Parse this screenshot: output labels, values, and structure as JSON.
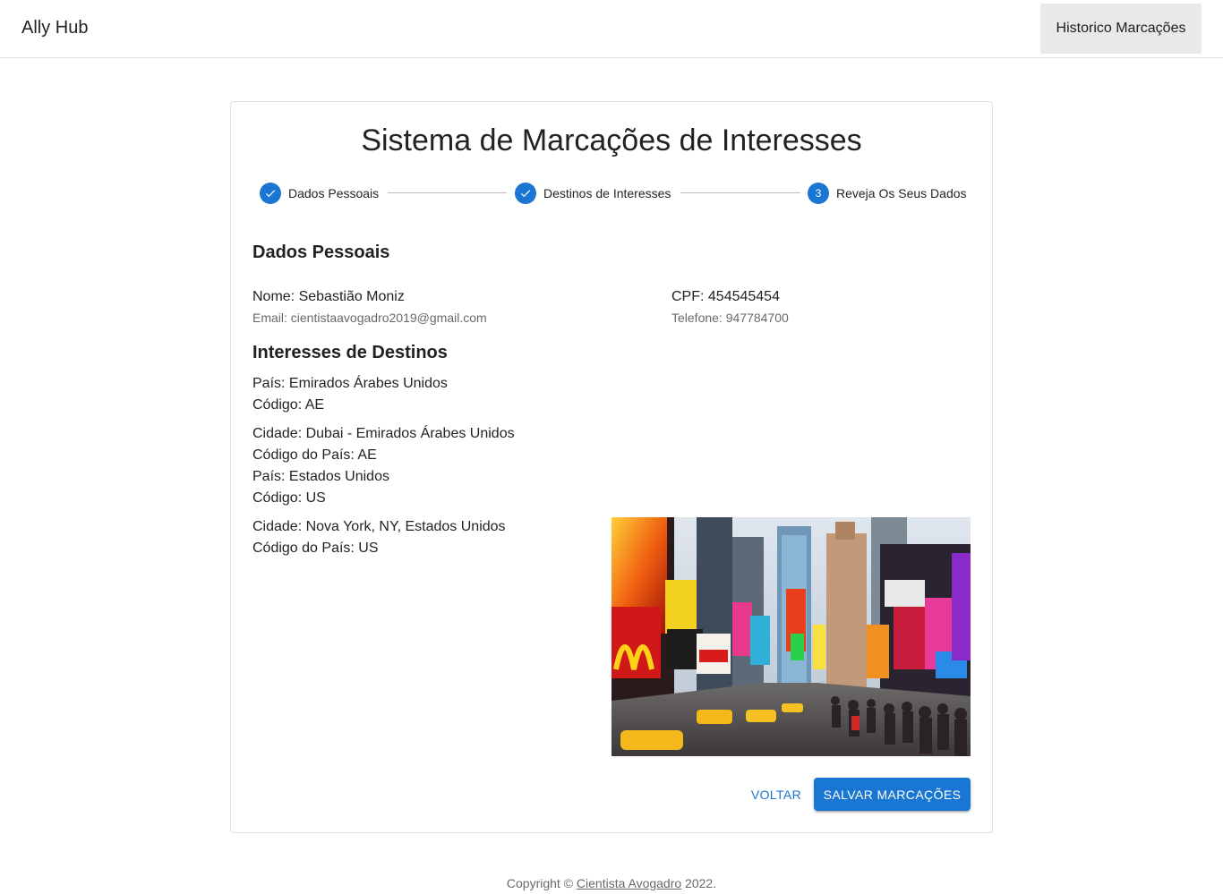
{
  "appbar": {
    "brand": "Ally Hub",
    "nav_button": "Historico Marcações"
  },
  "card": {
    "title": "Sistema de Marcações de Interesses",
    "steps": [
      {
        "label": "Dados Pessoais",
        "status": "completed",
        "icon": "check-icon"
      },
      {
        "label": "Destinos de Interesses",
        "status": "completed",
        "icon": "check-icon"
      },
      {
        "label": "Reveja Os Seus Dados",
        "status": "active",
        "number": "3"
      }
    ],
    "personal": {
      "heading": "Dados Pessoais",
      "name": "Nome: Sebastião Moniz",
      "email": "Email: cientistaavogadro2019@gmail.com",
      "cpf": "CPF: 454545454",
      "phone": "Telefone: 947784700"
    },
    "destinations": {
      "heading": "Interesses de Destinos",
      "items": [
        {
          "pais": "País: Emirados Árabes Unidos",
          "codigo": "Código: AE",
          "cidade": "Cidade: Dubai - Emirados Árabes Unidos",
          "codigo_pais": "Código do País: AE"
        },
        {
          "pais": "País: Estados Unidos",
          "codigo": "Código: US",
          "cidade": "Cidade: Nova York, NY, Estados Unidos",
          "codigo_pais": "Código do País: US"
        }
      ]
    },
    "image": {
      "subject": "Times Square, New York city street with billboards"
    },
    "actions": {
      "back": "VOLTAR",
      "save": "SALVAR MARCAÇÕES"
    }
  },
  "footer": {
    "prefix": "Copyright © ",
    "link": "Cientista Avogadro",
    "suffix": " 2022."
  },
  "colors": {
    "primary": "#1976d2",
    "nav_button_bg": "#e9e9ec",
    "border": "#e0e0e0"
  }
}
